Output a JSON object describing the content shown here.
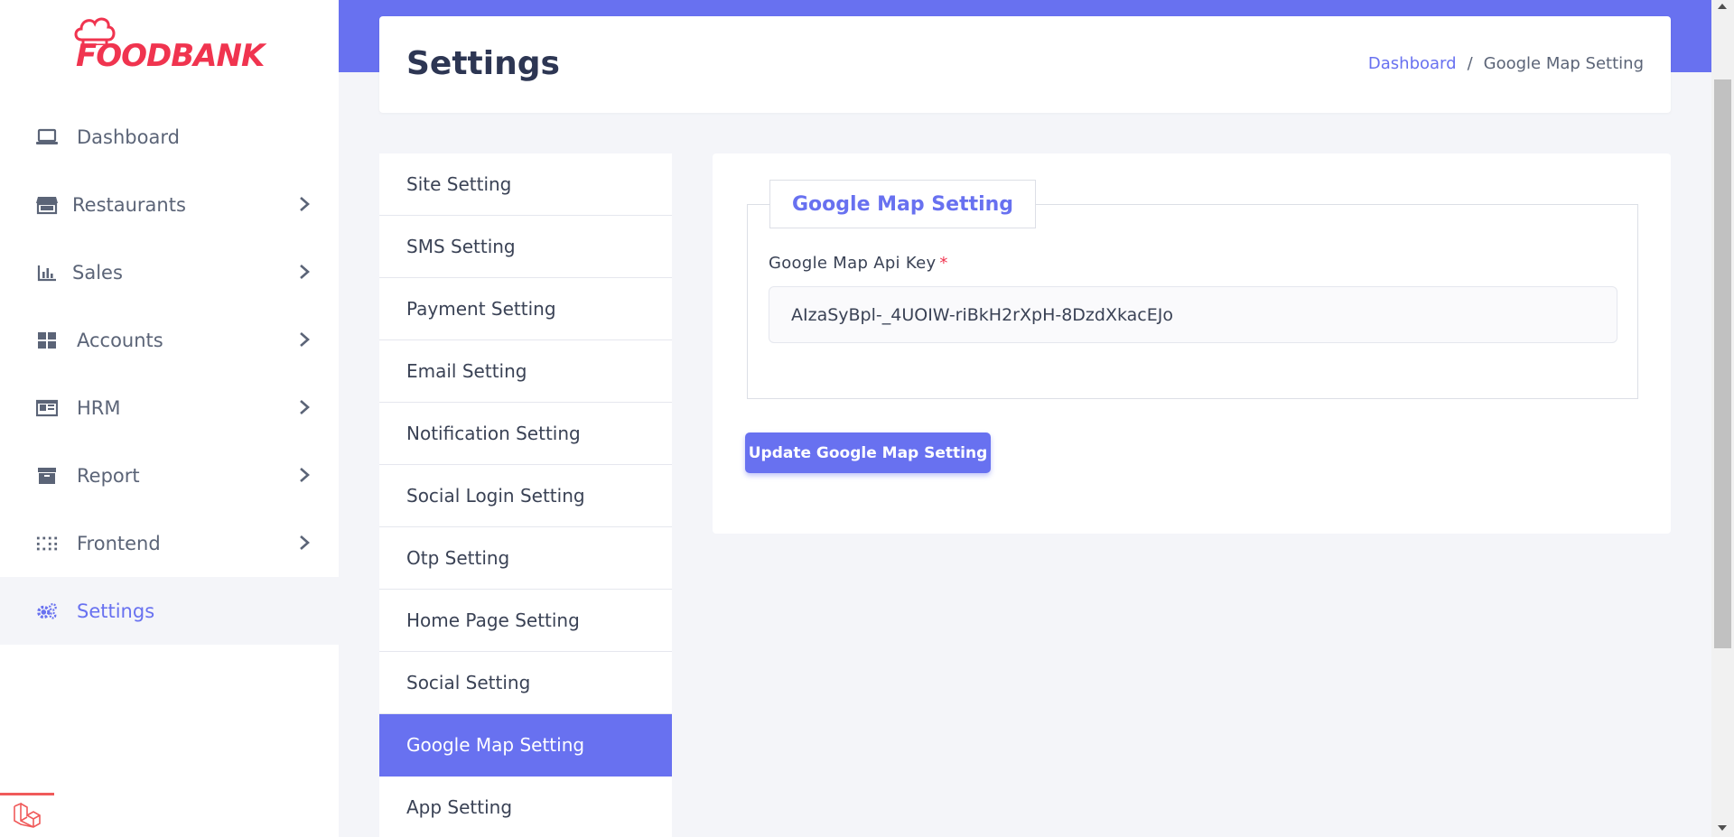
{
  "brand": {
    "name": "FOODBANK",
    "color": "#f0344f",
    "accent": "#6871f0"
  },
  "sidebar": {
    "items": [
      {
        "label": "Dashboard",
        "icon": "laptop-icon",
        "has_submenu": false,
        "active": false
      },
      {
        "label": "Restaurants",
        "icon": "store-icon",
        "has_submenu": true,
        "active": false
      },
      {
        "label": "Sales",
        "icon": "bar-chart-icon",
        "has_submenu": true,
        "active": false
      },
      {
        "label": "Accounts",
        "icon": "grid-icon",
        "has_submenu": true,
        "active": false
      },
      {
        "label": "HRM",
        "icon": "id-card-icon",
        "has_submenu": true,
        "active": false
      },
      {
        "label": "Report",
        "icon": "archive-icon",
        "has_submenu": true,
        "active": false
      },
      {
        "label": "Frontend",
        "icon": "dots-grid-icon",
        "has_submenu": true,
        "active": false
      },
      {
        "label": "Settings",
        "icon": "cogs-icon",
        "has_submenu": false,
        "active": true
      }
    ]
  },
  "header": {
    "title": "Settings",
    "breadcrumb": {
      "link": "Dashboard",
      "separator": "/",
      "current": "Google Map Setting"
    }
  },
  "settings_menu": {
    "items": [
      {
        "label": "Site Setting",
        "active": false
      },
      {
        "label": "SMS Setting",
        "active": false
      },
      {
        "label": "Payment Setting",
        "active": false
      },
      {
        "label": "Email Setting",
        "active": false
      },
      {
        "label": "Notification Setting",
        "active": false
      },
      {
        "label": "Social Login Setting",
        "active": false
      },
      {
        "label": "Otp Setting",
        "active": false
      },
      {
        "label": "Home Page Setting",
        "active": false
      },
      {
        "label": "Social Setting",
        "active": false
      },
      {
        "label": "Google Map Setting",
        "active": true
      },
      {
        "label": "App Setting",
        "active": false
      }
    ]
  },
  "form": {
    "legend": "Google Map Setting",
    "api_key_label": "Google Map Api Key",
    "required_mark": "*",
    "api_key_value": "AIzaSyBpl-_4UOIW-riBkH2rXpH-8DzdXkacEJo",
    "submit_label": "Update Google Map Setting"
  }
}
